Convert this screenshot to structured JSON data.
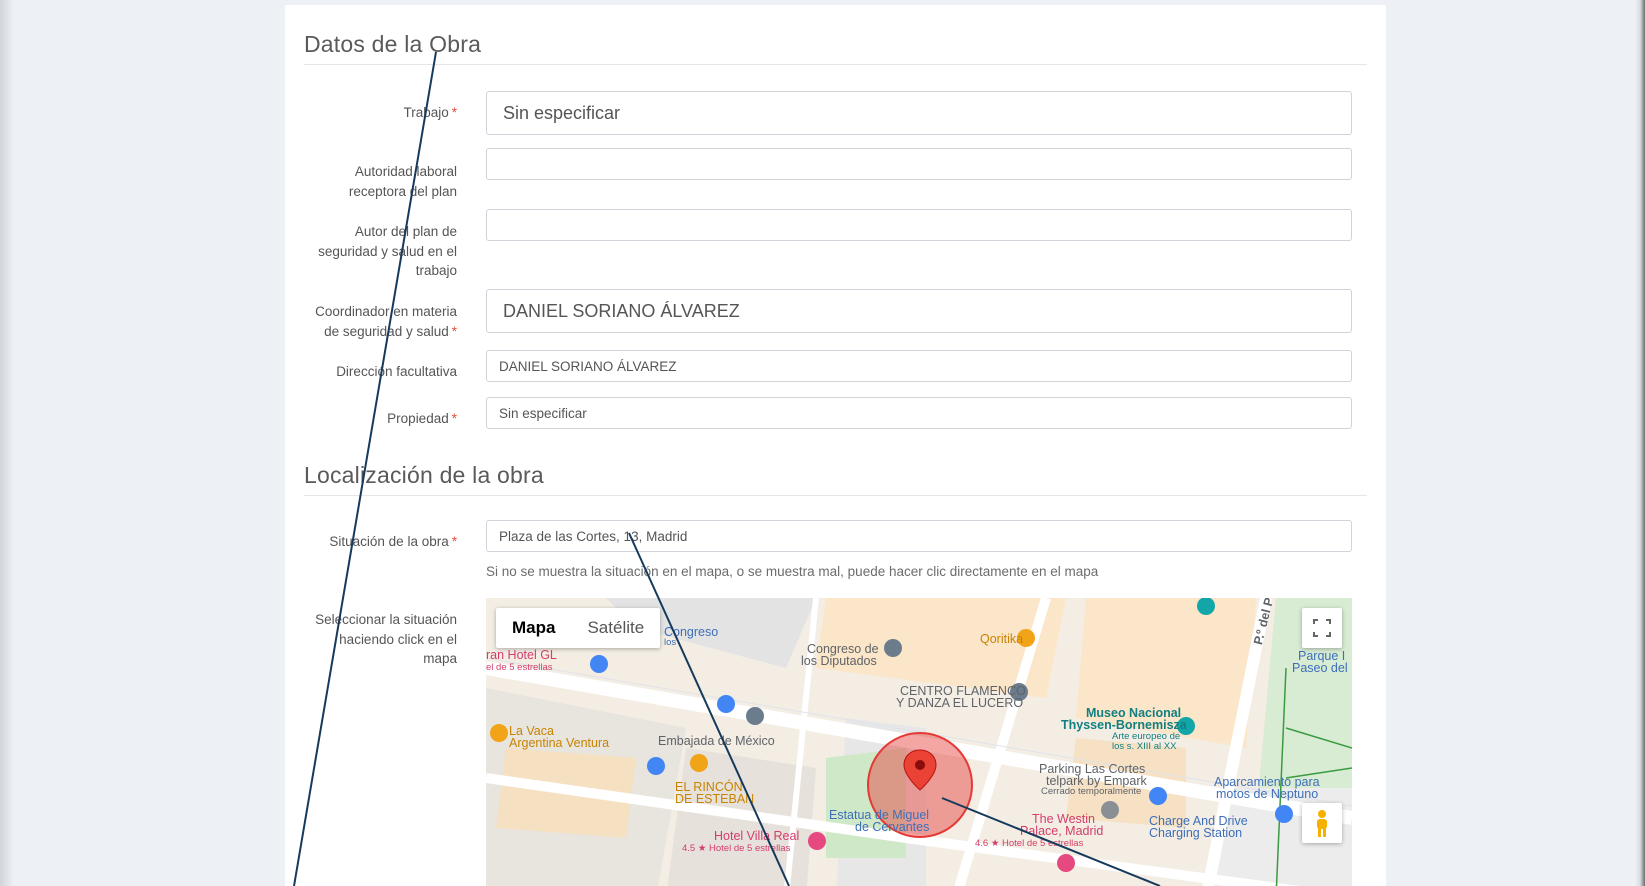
{
  "sections": {
    "obra_title": "Datos de la Obra",
    "localizacion_title": "Localización de la obra"
  },
  "form": {
    "trabajo": {
      "label": "Trabajo",
      "value": "Sin especificar",
      "required": true
    },
    "autoridad": {
      "label_line1": "Autoridad laboral",
      "label_line2": "receptora del plan",
      "value": ""
    },
    "autor": {
      "label_line1": "Autor del plan de",
      "label_line2": "seguridad y salud en el",
      "label_line3": "trabajo",
      "value": ""
    },
    "coordinador": {
      "label_line1": "Coordinador en materia",
      "label_line2": "de seguridad y salud",
      "value": "DANIEL SORIANO ÁLVAREZ",
      "required": true
    },
    "direccion": {
      "label": "Dirección facultativa",
      "value": "DANIEL SORIANO ÁLVAREZ"
    },
    "propiedad": {
      "label": "Propiedad",
      "value": "Sin especificar",
      "required": true
    },
    "situacion": {
      "label": "Situación de la obra",
      "value": "Plaza de las Cortes, 13, Madrid",
      "required": true
    },
    "situacion_help": "Si no se muestra la situación en el mapa, o se muestra mal, puede hacer clic directamente en el mapa",
    "seleccionar": {
      "label_line1": "Seleccionar la situación",
      "label_line2": "haciendo click en el",
      "label_line3": "mapa"
    }
  },
  "required_mark": "*",
  "map": {
    "type_buttons": [
      "Mapa",
      "Satélite"
    ],
    "active_type": "Mapa",
    "labels": {
      "congreso_top": "Congreso",
      "congreso_top_sub": "los",
      "gran_hotel": "ran Hotel GL",
      "gran_hotel_sub": "el de 5 estrellas",
      "congreso_diputados_1": "Congreso de",
      "congreso_diputados_2": "los Diputados",
      "qoritika": "Qoritika",
      "paseo_prado": "P.º del Prado",
      "parque": "Parque I",
      "paseo_del": "Paseo del",
      "centro_flamenco_1": "CENTRO FLAMENCO",
      "centro_flamenco_2": "Y DANZA EL LUCERO",
      "museo_1": "Museo Nacional",
      "museo_2": "Thyssen-Bornemisza",
      "museo_sub_1": "Arte europeo de",
      "museo_sub_2": "los s. XIII al XX",
      "la_vaca_1": "La Vaca",
      "la_vaca_2": "Argentina Ventura",
      "embajada": "Embajada de México",
      "parking_1": "Parking Las Cortes",
      "parking_2": "telpark by Empark",
      "parking_sub": "Cerrado temporalmente",
      "aparcamiento_1": "Aparcamiento para",
      "aparcamiento_2": "motos de Neptuno",
      "rincon_1": "EL RINCÓN",
      "rincon_2": "DE ESTEBAN",
      "estatua_1": "Estatua de Miguel",
      "estatua_2": "de Cervantes",
      "westin_1": "The Westin",
      "westin_2": "Palace, Madrid",
      "westin_sub": "4.6 ★ Hotel de 5 estrellas",
      "charge_1": "Charge And Drive",
      "charge_2": "Charging Station",
      "villa_real": "Hotel Villa Real",
      "villa_real_sub": "4.5 ★ Hotel de 5 estrellas"
    }
  },
  "colors": {
    "accent_line": "#163a5c",
    "required": "#e74c3c",
    "marker_red": "#ea4335",
    "circle_fill": "#e53935",
    "park_green": "#cfe8c8"
  }
}
